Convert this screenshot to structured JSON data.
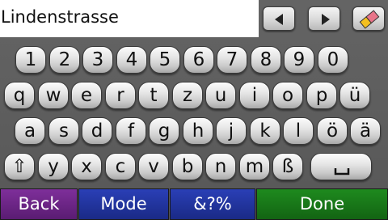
{
  "input": {
    "value": "Lindenstrasse"
  },
  "toolbar": {
    "left_icon": "cursor-left-icon",
    "right_icon": "cursor-right-icon",
    "erase_icon": "eraser-icon"
  },
  "keyboard": {
    "row1": [
      "1",
      "2",
      "3",
      "4",
      "5",
      "6",
      "7",
      "8",
      "9",
      "0"
    ],
    "row2": [
      "q",
      "w",
      "e",
      "r",
      "t",
      "z",
      "u",
      "i",
      "o",
      "p",
      "ü"
    ],
    "row3": [
      "a",
      "s",
      "d",
      "f",
      "g",
      "h",
      "j",
      "k",
      "l",
      "ö",
      "ä"
    ],
    "row4": [
      "⇧",
      "y",
      "x",
      "c",
      "v",
      "b",
      "n",
      "m",
      "ß"
    ],
    "space_icon": "space-bar-icon"
  },
  "bottom": {
    "back": "Back",
    "mode": "Mode",
    "symbols": "&?%",
    "done": "Done"
  },
  "colors": {
    "back": "#6a2485",
    "mode": "#22339e",
    "symbols": "#22339e",
    "done": "#197719"
  }
}
